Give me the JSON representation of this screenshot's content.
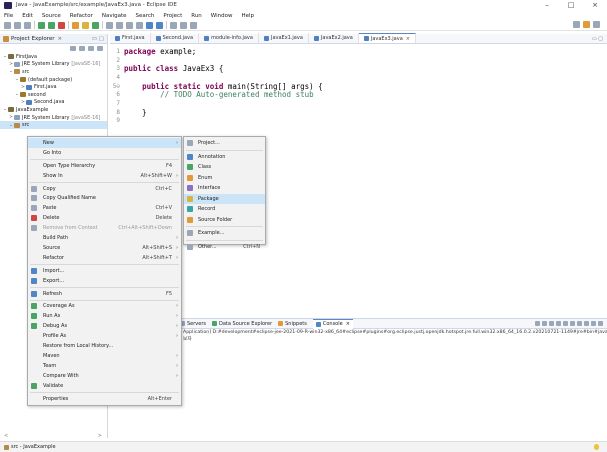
{
  "window": {
    "title": "Java - JavaExample/src/example/JavaEx3.java - Eclipse IDE",
    "controls": [
      "–",
      "□",
      "×"
    ]
  },
  "menubar": [
    "File",
    "Edit",
    "Source",
    "Refactor",
    "Navigate",
    "Search",
    "Project",
    "Run",
    "Window",
    "Help"
  ],
  "package_explorer": {
    "tab_label": "Project Explorer",
    "tab_close": "×",
    "tab_buttons": "▭ ▢",
    "tree": [
      {
        "arrow": "⌄",
        "icon": "project-icon",
        "label": "FirstJava",
        "decoration": "",
        "selected": false
      },
      {
        "arrow": ">",
        "icon": "library-icon",
        "label": "JRE System Library",
        "decoration": "[JavaSE-16]",
        "selected": false
      },
      {
        "arrow": "⌄",
        "icon": "source-folder-icon",
        "label": "src",
        "decoration": "",
        "selected": false
      },
      {
        "arrow": "⌄",
        "icon": "package-icon",
        "label": "(default package)",
        "decoration": "",
        "selected": false
      },
      {
        "arrow": ">",
        "icon": "java-file-icon",
        "label": "First.java",
        "decoration": "",
        "selected": false
      },
      {
        "arrow": "⌄",
        "icon": "package-icon",
        "label": "second",
        "decoration": "",
        "selected": false
      },
      {
        "arrow": ">",
        "icon": "java-file-icon",
        "label": "Second.java",
        "decoration": "",
        "selected": false
      },
      {
        "arrow": "⌄",
        "icon": "project-icon",
        "label": "JavaExample",
        "decoration": "",
        "selected": false
      },
      {
        "arrow": ">",
        "icon": "library-icon",
        "label": "JRE System Library",
        "decoration": "[JavaSE-16]",
        "selected": false
      },
      {
        "arrow": "⌄",
        "icon": "source-folder-icon",
        "label": "src",
        "decoration": "",
        "selected": true
      }
    ]
  },
  "editor": {
    "tabs": [
      {
        "label": "First.java",
        "active": false
      },
      {
        "label": "Second.java",
        "active": false
      },
      {
        "label": "module-info.java",
        "active": false
      },
      {
        "label": "JavaEx1.java",
        "active": false
      },
      {
        "label": "JavaEx2.java",
        "active": false
      },
      {
        "label": "JavaEx3.java",
        "active": true,
        "close": "×"
      }
    ],
    "tabs_right": "▭ ▢",
    "lines": [
      {
        "n": "1",
        "parts": [
          [
            "kw",
            "package"
          ],
          [
            "",
            " example;"
          ]
        ]
      },
      {
        "n": "2",
        "parts": []
      },
      {
        "n": "3",
        "parts": [
          [
            "kw",
            "public"
          ],
          [
            "",
            " "
          ],
          [
            "kw",
            "class"
          ],
          [
            "",
            " JavaEx3 {"
          ]
        ]
      },
      {
        "n": "4",
        "parts": []
      },
      {
        "n": "5⊖",
        "parts": [
          [
            "",
            "    "
          ],
          [
            "kw",
            "public"
          ],
          [
            "",
            " "
          ],
          [
            "kw",
            "static"
          ],
          [
            "",
            " "
          ],
          [
            "kw",
            "void"
          ],
          [
            "",
            " main(String[] args) {"
          ]
        ]
      },
      {
        "n": "6",
        "parts": [
          [
            "cm",
            "        // TODO Auto-generated method stub"
          ]
        ]
      },
      {
        "n": "7",
        "parts": []
      },
      {
        "n": "8",
        "parts": [
          [
            "",
            "    }"
          ]
        ]
      },
      {
        "n": "9",
        "parts": []
      }
    ]
  },
  "context_menu": {
    "items": [
      {
        "label": "New",
        "accel": "",
        "submenu": true,
        "icon": "none",
        "highlight": true,
        "disabled": false
      },
      {
        "label": "Go Into",
        "accel": "",
        "submenu": false,
        "icon": "none",
        "highlight": false,
        "disabled": false
      },
      {
        "sep": true
      },
      {
        "label": "Open Type Hierarchy",
        "accel": "F4",
        "submenu": false,
        "icon": "none",
        "highlight": false,
        "disabled": false
      },
      {
        "label": "Show In",
        "accel": "Alt+Shift+W",
        "submenu": true,
        "icon": "none",
        "highlight": false,
        "disabled": false
      },
      {
        "sep": true
      },
      {
        "label": "Copy",
        "accel": "Ctrl+C",
        "submenu": false,
        "icon": "copy-icon",
        "highlight": false,
        "disabled": false
      },
      {
        "label": "Copy Qualified Name",
        "accel": "",
        "submenu": false,
        "icon": "copy-qualified-icon",
        "highlight": false,
        "disabled": false
      },
      {
        "label": "Paste",
        "accel": "Ctrl+V",
        "submenu": false,
        "icon": "paste-icon",
        "highlight": false,
        "disabled": false
      },
      {
        "label": "Delete",
        "accel": "Delete",
        "submenu": false,
        "icon": "delete-icon",
        "highlight": false,
        "disabled": false
      },
      {
        "label": "Remove from Context",
        "accel": "Ctrl+Alt+Shift+Down",
        "submenu": false,
        "icon": "remove-context-icon",
        "highlight": false,
        "disabled": true
      },
      {
        "label": "Build Path",
        "accel": "",
        "submenu": true,
        "icon": "none",
        "highlight": false,
        "disabled": false
      },
      {
        "label": "Source",
        "accel": "Alt+Shift+S",
        "submenu": true,
        "icon": "none",
        "highlight": false,
        "disabled": false
      },
      {
        "label": "Refactor",
        "accel": "Alt+Shift+T",
        "submenu": true,
        "icon": "none",
        "highlight": false,
        "disabled": false
      },
      {
        "sep": true
      },
      {
        "label": "Import...",
        "accel": "",
        "submenu": false,
        "icon": "import-icon",
        "highlight": false,
        "disabled": false
      },
      {
        "label": "Export...",
        "accel": "",
        "submenu": false,
        "icon": "export-icon",
        "highlight": false,
        "disabled": false
      },
      {
        "sep": true
      },
      {
        "label": "Refresh",
        "accel": "F5",
        "submenu": false,
        "icon": "refresh-icon",
        "highlight": false,
        "disabled": false
      },
      {
        "sep": true
      },
      {
        "label": "Coverage As",
        "accel": "",
        "submenu": true,
        "icon": "coverage-icon",
        "highlight": false,
        "disabled": false
      },
      {
        "label": "Run As",
        "accel": "",
        "submenu": true,
        "icon": "run-icon",
        "highlight": false,
        "disabled": false
      },
      {
        "label": "Debug As",
        "accel": "",
        "submenu": true,
        "icon": "debug-icon",
        "highlight": false,
        "disabled": false
      },
      {
        "label": "Profile As",
        "accel": "",
        "submenu": true,
        "icon": "none",
        "highlight": false,
        "disabled": false
      },
      {
        "label": "Restore from Local History...",
        "accel": "",
        "submenu": false,
        "icon": "none",
        "highlight": false,
        "disabled": false
      },
      {
        "label": "Maven",
        "accel": "",
        "submenu": true,
        "icon": "none",
        "highlight": false,
        "disabled": false
      },
      {
        "label": "Team",
        "accel": "",
        "submenu": true,
        "icon": "none",
        "highlight": false,
        "disabled": false
      },
      {
        "label": "Compare With",
        "accel": "",
        "submenu": true,
        "icon": "none",
        "highlight": false,
        "disabled": false
      },
      {
        "label": "Validate",
        "accel": "",
        "submenu": false,
        "icon": "validate-icon",
        "highlight": false,
        "disabled": false
      },
      {
        "sep": true
      },
      {
        "label": "Properties",
        "accel": "Alt+Enter",
        "submenu": false,
        "icon": "none",
        "highlight": false,
        "disabled": false
      }
    ]
  },
  "new_submenu": {
    "items": [
      {
        "label": "Project...",
        "accel": "",
        "icon": "project-wizard-icon",
        "highlight": false
      },
      {
        "sep": true
      },
      {
        "label": "Annotation",
        "accel": "",
        "icon": "annotation-icon",
        "highlight": false
      },
      {
        "label": "Class",
        "accel": "",
        "icon": "class-icon",
        "highlight": false
      },
      {
        "label": "Enum",
        "accel": "",
        "icon": "enum-icon",
        "highlight": false
      },
      {
        "label": "Interface",
        "accel": "",
        "icon": "interface-icon",
        "highlight": false
      },
      {
        "label": "Package",
        "accel": "",
        "icon": "package-new-icon",
        "highlight": true
      },
      {
        "label": "Record",
        "accel": "",
        "icon": "record-icon",
        "highlight": false
      },
      {
        "label": "Source Folder",
        "accel": "",
        "icon": "source-folder-new-icon",
        "highlight": false
      },
      {
        "sep": true
      },
      {
        "label": "Example...",
        "accel": "",
        "icon": "example-icon",
        "highlight": false
      },
      {
        "sep": true
      },
      {
        "label": "Other...",
        "accel": "Ctrl+N",
        "icon": "other-icon",
        "highlight": false
      }
    ]
  },
  "console": {
    "tabs": [
      {
        "label": "Servers",
        "icon": "servers-icon",
        "active": false
      },
      {
        "label": "Data Source Explorer",
        "icon": "data-source-icon",
        "active": false
      },
      {
        "label": "Snippets",
        "icon": "snippets-icon",
        "active": false
      },
      {
        "label": "Console",
        "icon": "console-icon",
        "active": true,
        "close": "×"
      }
    ],
    "line1": "Application] D:#development#eclipse-jee-2021-09-R-win32-x86_64#eclipse#plugins#org.eclipse.justj.openjdk.hotspot.jre.full.win32.x86_64_16.0.2.v20210721-1149#jre#bin#javaw.exe",
    "line2": "보자"
  },
  "scroll": {
    "left": "<",
    "right": ">"
  },
  "status": {
    "label": "src - JavaExample"
  }
}
